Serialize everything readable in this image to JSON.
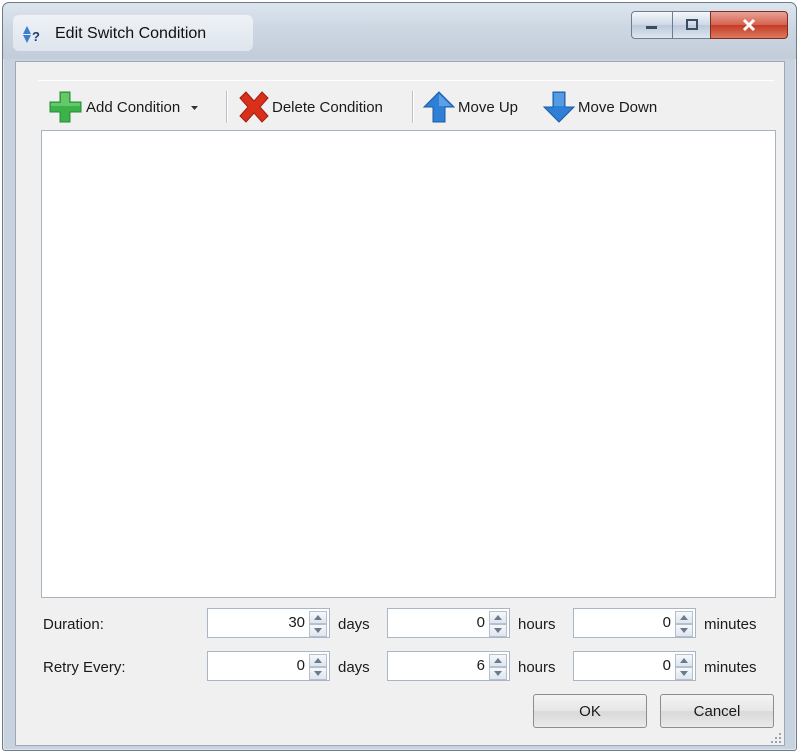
{
  "window": {
    "title": "Edit Switch Condition"
  },
  "toolbar": {
    "add_condition": "Add Condition",
    "delete_condition": "Delete Condition",
    "move_up": "Move Up",
    "move_down": "Move Down"
  },
  "duration": {
    "label": "Duration:",
    "days": "30",
    "days_unit": "days",
    "hours": "0",
    "hours_unit": "hours",
    "minutes": "0",
    "minutes_unit": "minutes"
  },
  "retry": {
    "label": "Retry Every:",
    "days": "0",
    "days_unit": "days",
    "hours": "6",
    "hours_unit": "hours",
    "minutes": "0",
    "minutes_unit": "minutes"
  },
  "buttons": {
    "ok": "OK",
    "cancel": "Cancel"
  },
  "colors": {
    "add_icon": "#3cb34a",
    "delete_icon": "#d9301c",
    "arrow_icon": "#2f7fd6",
    "close_button": "#c43a25"
  }
}
